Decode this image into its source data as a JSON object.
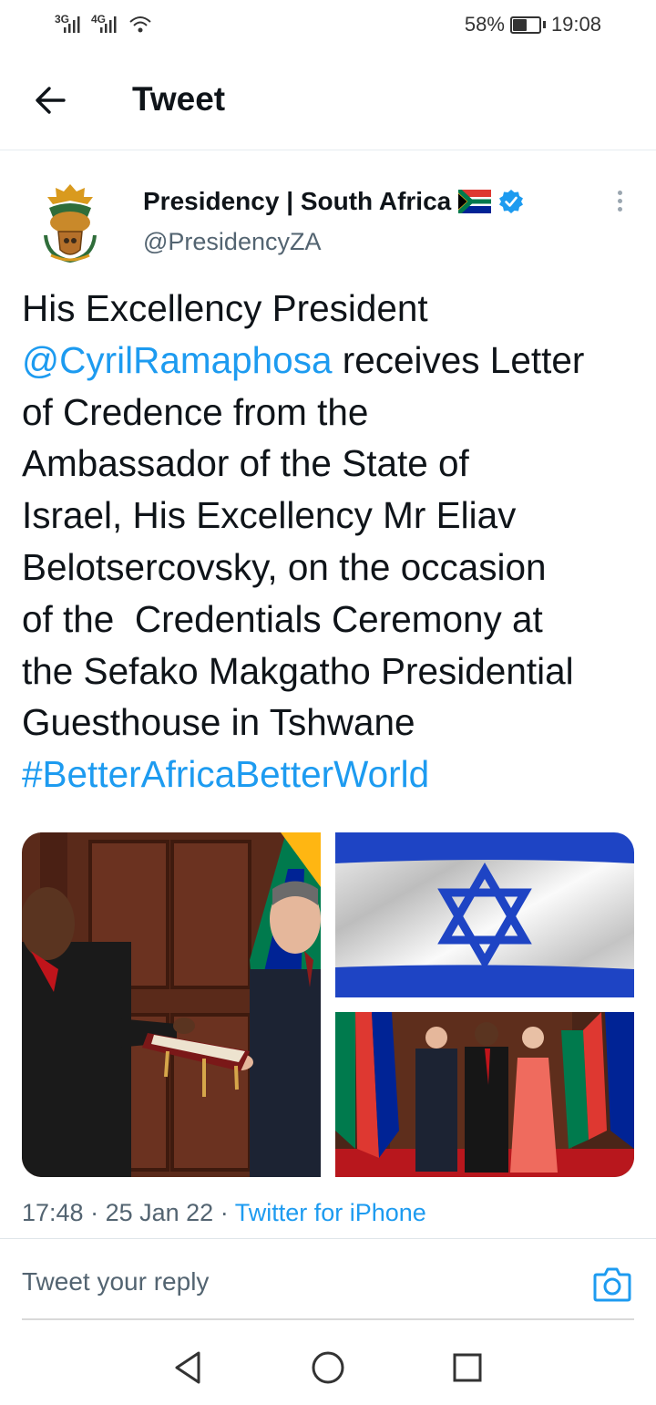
{
  "status_bar": {
    "signal_1": "3G",
    "signal_2": "4G",
    "battery": "58%",
    "battery_level": 0.58,
    "time": "19:08"
  },
  "header": {
    "back_icon": "arrow-left-icon",
    "title": "Tweet"
  },
  "tweet": {
    "author_name": "Presidency | South Africa",
    "handle": "@PresidencyZA",
    "lines": [
      [
        "His Excellency President",
        ""
      ],
      [
        "",
        "@CyrilRamaphosa",
        " receives Letter"
      ],
      [
        "of Credence from the"
      ],
      [
        "Ambassador of the State of"
      ],
      [
        "Israel, His Excellency Mr Eliav"
      ],
      [
        "Belotsercovsky, on the occasion"
      ],
      [
        "of the  Credentials Ceremony at"
      ],
      [
        "the Sefako Makgatho Presidential"
      ],
      [
        "Guesthouse in Tshwane"
      ]
    ],
    "mention": "@CyrilRamaphosa",
    "hashtag": "#BetterAfricaBetterWorld",
    "time": "17:48",
    "date": "25 Jan 22",
    "source": "Twitter for iPhone"
  },
  "reply": {
    "placeholder": "Tweet your reply"
  },
  "colors": {
    "link": "#1d9bf0",
    "verified": "#1d9bf0",
    "muted": "#536471"
  }
}
